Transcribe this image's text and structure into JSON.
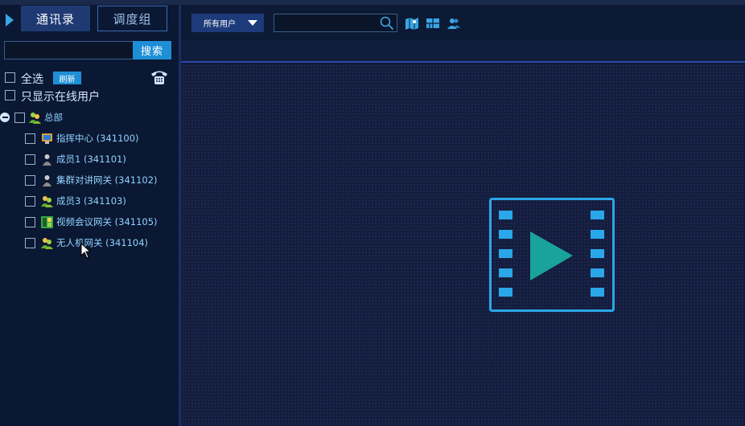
{
  "tabs": [
    {
      "label": "通讯录",
      "active": true
    },
    {
      "label": "调度组",
      "active": false
    }
  ],
  "left_search": {
    "value": "",
    "button_label": "搜索"
  },
  "select_all_label": "全选",
  "refresh_label": "刷新",
  "online_only_label": "只显示在线用户",
  "tree": {
    "root": {
      "label": "总部",
      "icon": "user-group-icon"
    },
    "children": [
      {
        "label": "指挥中心 (341100)",
        "icon": "monitor-icon"
      },
      {
        "label": "成员1 (341101)",
        "icon": "user-gray-icon"
      },
      {
        "label": "集群对讲网关 (341102)",
        "icon": "user-gray-icon"
      },
      {
        "label": "成员3 (341103)",
        "icon": "user-green-icon"
      },
      {
        "label": "视频会议网关 (341105)",
        "icon": "video-conference-icon"
      },
      {
        "label": "无人机网关 (341104)",
        "icon": "user-green-icon"
      }
    ]
  },
  "toolbar": {
    "user_filter": "所有用户",
    "search_value": "",
    "icons": [
      "search-icon",
      "map-icon",
      "layout-icon",
      "contacts-icon"
    ]
  },
  "colors": {
    "accent": "#1e8fd6",
    "tree_text": "#8fd2ff",
    "film": "#2aa7e8",
    "play": "#1aa39a"
  }
}
